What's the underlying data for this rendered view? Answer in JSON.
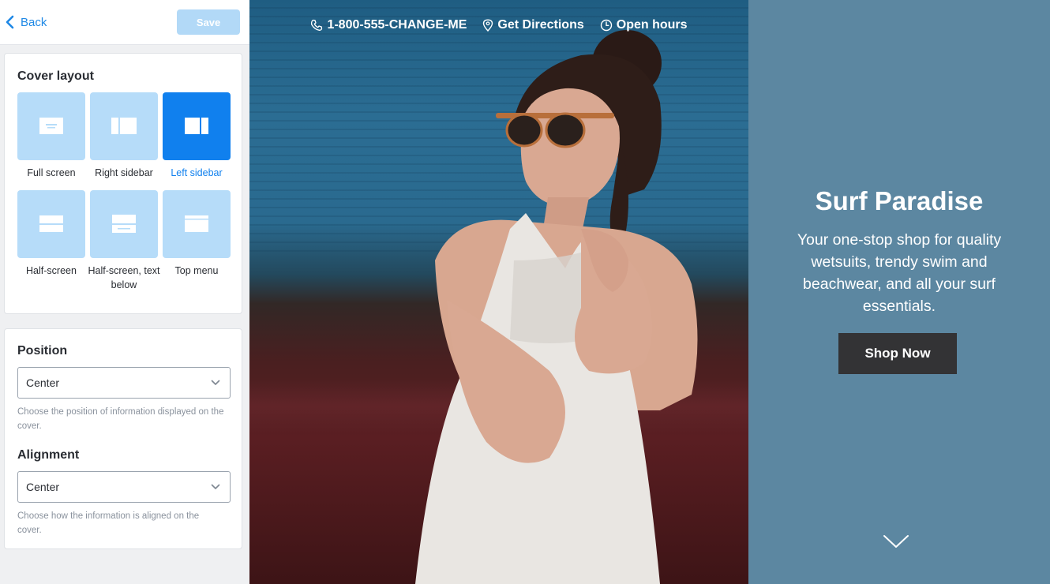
{
  "topbar": {
    "back_label": "Back",
    "save_label": "Save"
  },
  "cover_layout": {
    "title": "Cover layout",
    "selected": "Left sidebar",
    "options": [
      {
        "label": "Full screen",
        "icon": "layout-full-screen-icon"
      },
      {
        "label": "Right sidebar",
        "icon": "layout-right-sidebar-icon"
      },
      {
        "label": "Left sidebar",
        "icon": "layout-left-sidebar-icon"
      },
      {
        "label": "Half-screen",
        "icon": "layout-half-screen-icon"
      },
      {
        "label": "Half-screen, text below",
        "icon": "layout-half-screen-text-below-icon"
      },
      {
        "label": "Top menu",
        "icon": "layout-top-menu-icon"
      }
    ]
  },
  "position": {
    "title": "Position",
    "value": "Center",
    "hint": "Choose the position of information displayed on the cover."
  },
  "alignment": {
    "title": "Alignment",
    "value": "Center",
    "hint": "Choose how the information is aligned on the cover."
  },
  "preview": {
    "phone": "1-800-555-CHANGE-ME",
    "directions": "Get Directions",
    "hours": "Open hours",
    "headline": "Surf Paradise",
    "tagline": "Your one-stop shop for quality wetsuits, trendy swim and beachwear, and all your surf essentials.",
    "cta": "Shop Now"
  },
  "colors": {
    "accent": "#1080ee",
    "tile_inactive": "#b6dcf9",
    "sidebar_bg": "#5c87a1",
    "cta_bg": "#333335"
  }
}
